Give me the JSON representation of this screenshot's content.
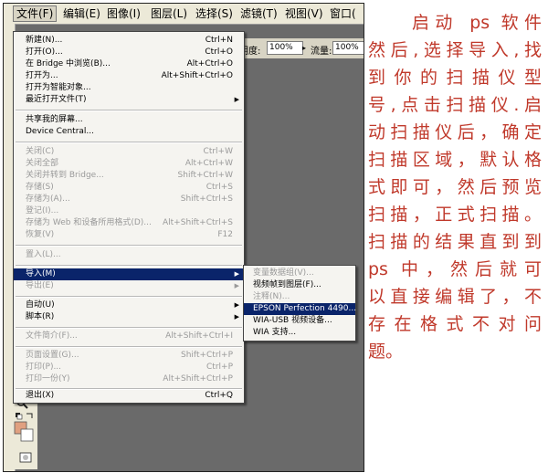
{
  "menubar": {
    "items": [
      {
        "label": "文件(F)"
      },
      {
        "label": "编辑(E)"
      },
      {
        "label": "图像(I)"
      },
      {
        "label": "图层(L)"
      },
      {
        "label": "选择(S)"
      },
      {
        "label": "滤镜(T)"
      },
      {
        "label": "视图(V)"
      },
      {
        "label": "窗口("
      }
    ]
  },
  "options_bar": {
    "opacity_label": "明度:",
    "opacity_value": "100%",
    "flow_label": "流量:",
    "flow_value": "100%"
  },
  "file_menu": {
    "items": [
      {
        "label": "新建(N)...",
        "shortcut": "Ctrl+N"
      },
      {
        "label": "打开(O)...",
        "shortcut": "Ctrl+O"
      },
      {
        "label": "在 Bridge 中浏览(B)...",
        "shortcut": "Alt+Ctrl+O"
      },
      {
        "label": "打开为...",
        "shortcut": "Alt+Shift+Ctrl+O"
      },
      {
        "label": "打开为智能对象..."
      },
      {
        "label": "最近打开文件(T)"
      },
      {
        "label": "共享我的屏幕..."
      },
      {
        "label": "Device Central..."
      },
      {
        "label": "关闭(C)",
        "shortcut": "Ctrl+W"
      },
      {
        "label": "关闭全部",
        "shortcut": "Alt+Ctrl+W"
      },
      {
        "label": "关闭并转到 Bridge...",
        "shortcut": "Shift+Ctrl+W"
      },
      {
        "label": "存储(S)",
        "shortcut": "Ctrl+S"
      },
      {
        "label": "存储为(A)...",
        "shortcut": "Shift+Ctrl+S"
      },
      {
        "label": "登记(I)..."
      },
      {
        "label": "存储为 Web 和设备所用格式(D)...",
        "shortcut": "Alt+Shift+Ctrl+S"
      },
      {
        "label": "恢复(V)",
        "shortcut": "F12"
      },
      {
        "label": "置入(L)..."
      },
      {
        "label": "导入(M)"
      },
      {
        "label": "导出(E)"
      },
      {
        "label": "自动(U)"
      },
      {
        "label": "脚本(R)"
      },
      {
        "label": "文件简介(F)...",
        "shortcut": "Alt+Shift+Ctrl+I"
      },
      {
        "label": "页面设置(G)...",
        "shortcut": "Shift+Ctrl+P"
      },
      {
        "label": "打印(P)...",
        "shortcut": "Ctrl+P"
      },
      {
        "label": "打印一份(Y)",
        "shortcut": "Alt+Shift+Ctrl+P"
      },
      {
        "label": "退出(X)",
        "shortcut": "Ctrl+Q"
      }
    ]
  },
  "import_submenu": {
    "items": [
      {
        "label": "变量数据组(V)..."
      },
      {
        "label": "视频帧到图层(F)..."
      },
      {
        "label": "注释(N)..."
      },
      {
        "label": "EPSON Perfection 4490..."
      },
      {
        "label": "WIA-USB 视频设备..."
      },
      {
        "label": "WIA 支持..."
      }
    ]
  },
  "caption": {
    "lines": [
      "启动 ps 软件",
      "然后,选择导入,找",
      "到你的扫描仪型",
      "号,点击扫描仪.启",
      "动扫描仪后，确定",
      "扫描区域，默认格",
      "式即可，然后预览",
      "扫描，正式扫描。",
      "扫描的结果直到到",
      "ps 中，然后就可",
      "以直接编辑了，不",
      "存在格式不对问",
      "题。"
    ]
  },
  "colors": {
    "highlight": "#0a246a",
    "caption_text": "#c0392b",
    "workspace": "#6a6a6a",
    "foreground_swatch": "#e0a080"
  }
}
